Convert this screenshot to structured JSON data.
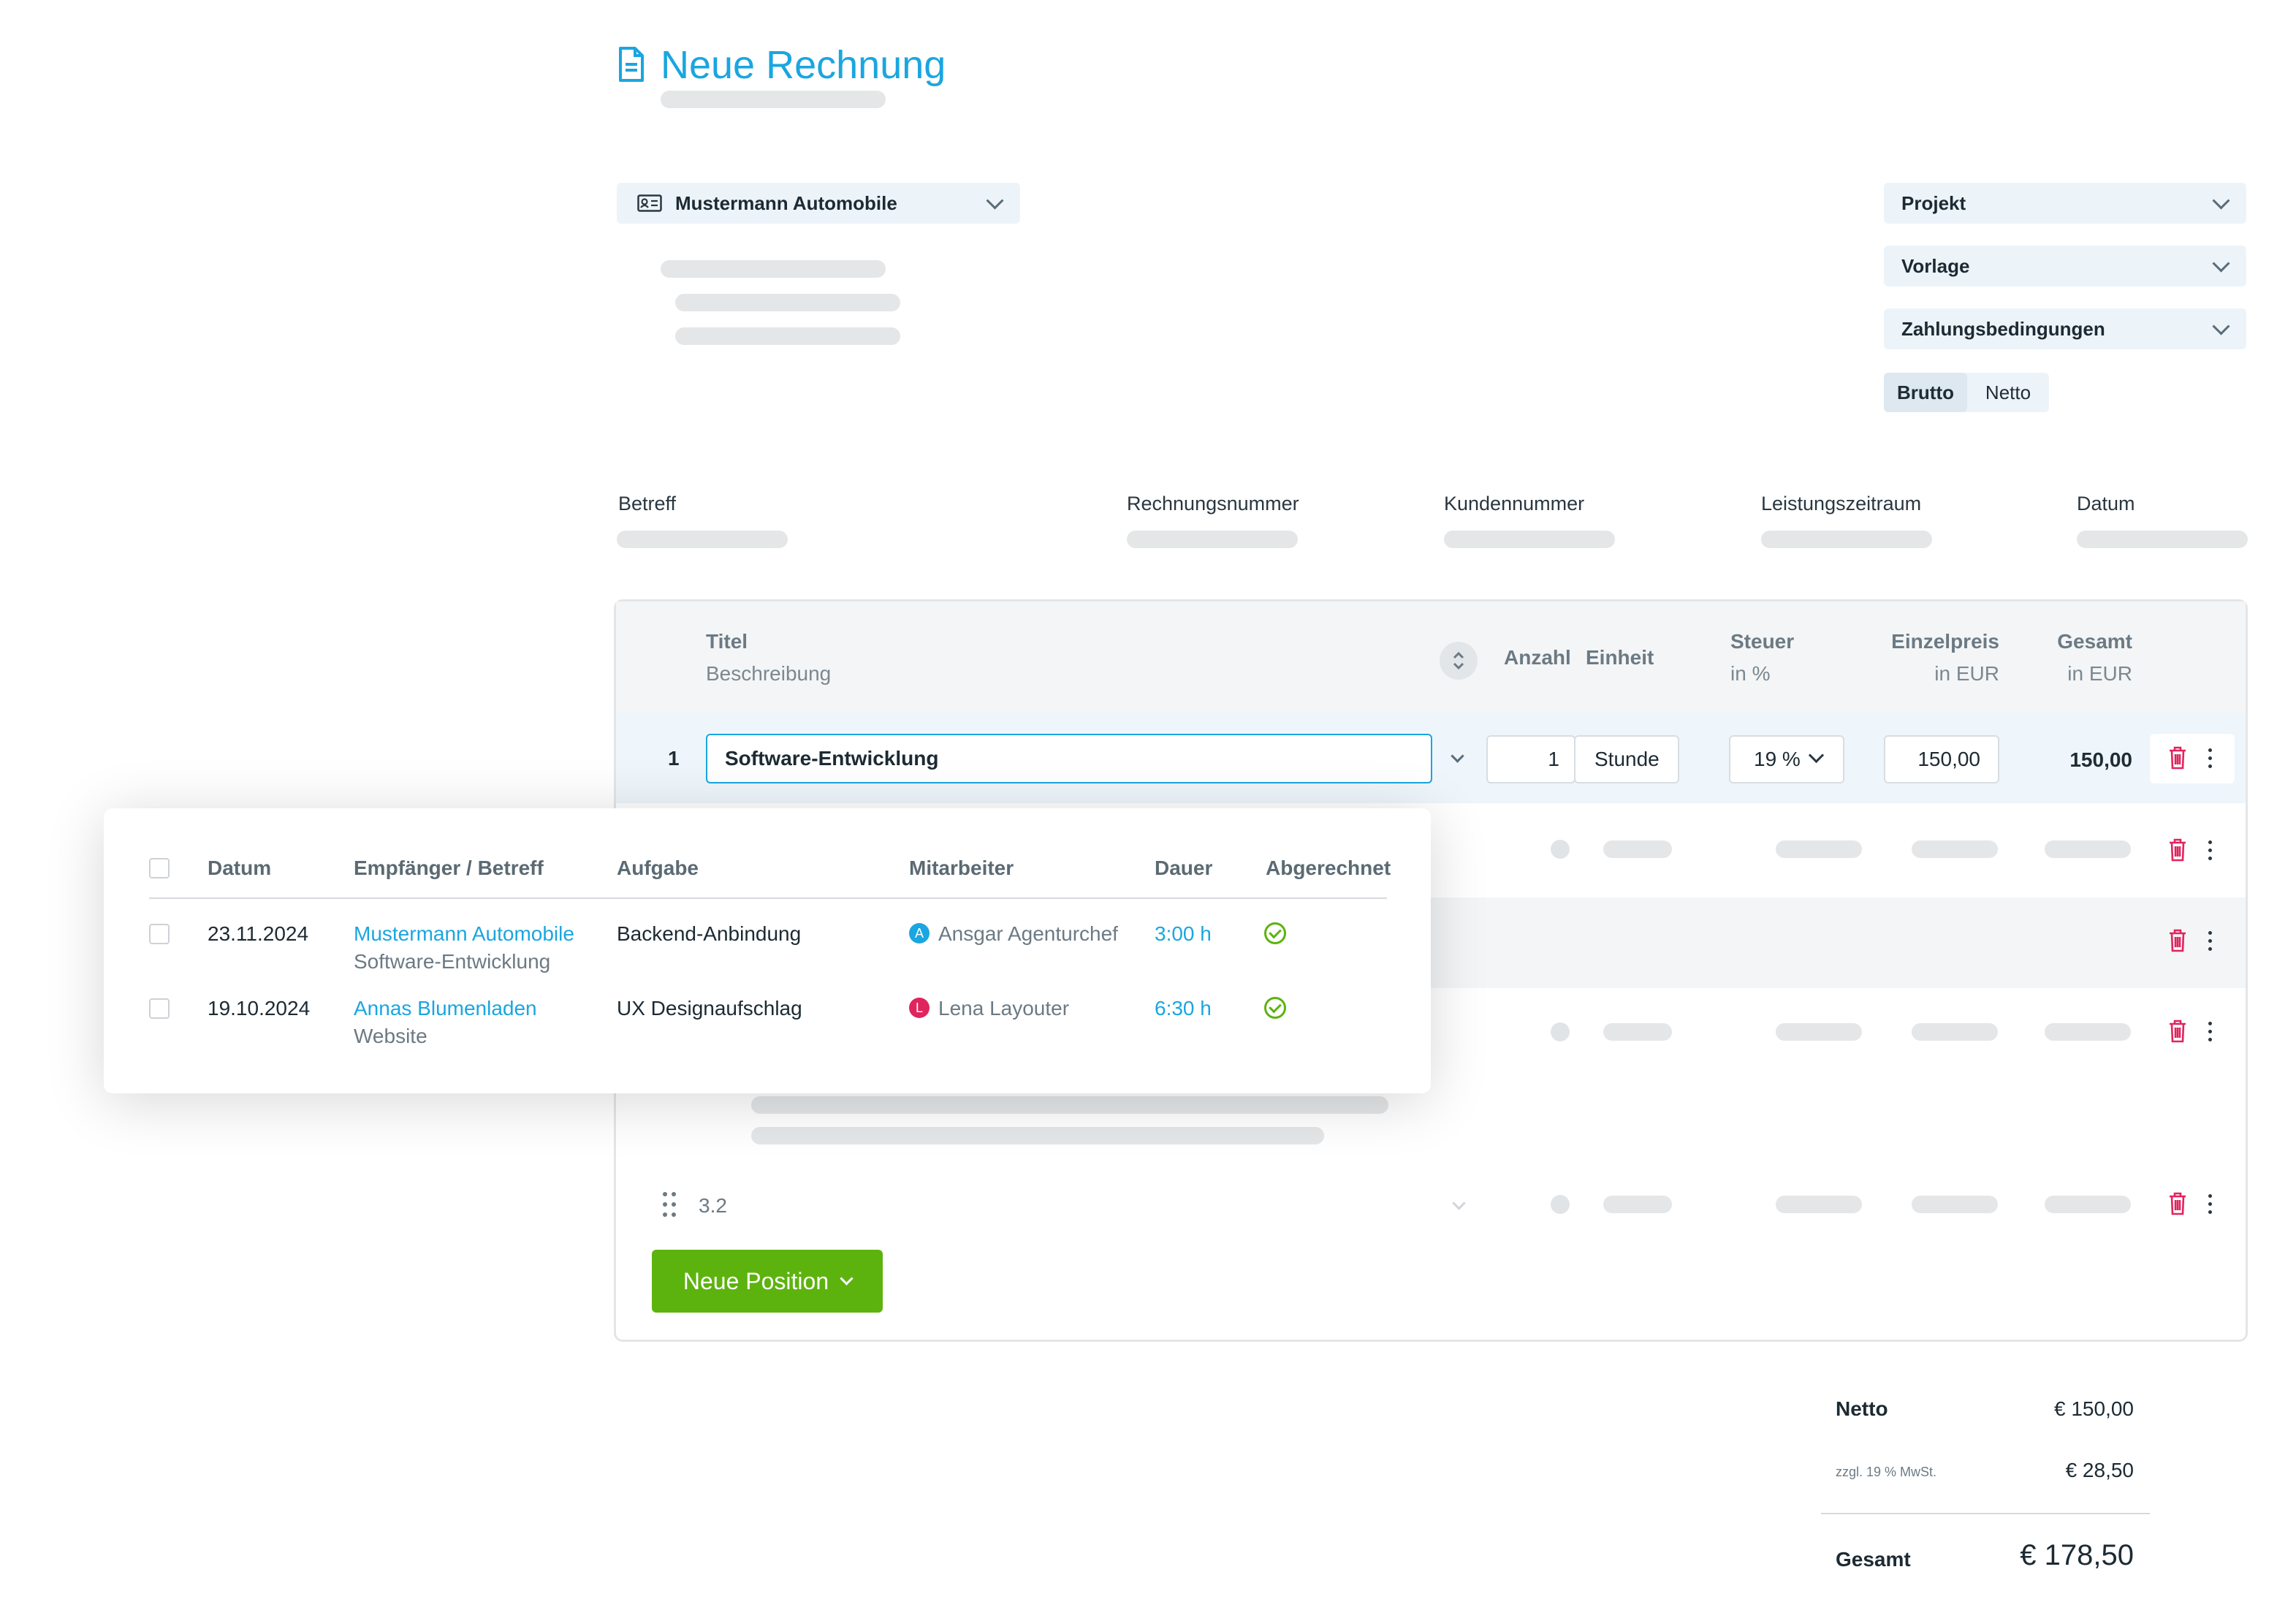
{
  "header": {
    "title": "Neue Rechnung",
    "icon": "document-icon"
  },
  "customer_select": {
    "label": "Mustermann Automobile",
    "icon": "contact-card-icon"
  },
  "right_selects": [
    {
      "label": "Projekt"
    },
    {
      "label": "Vorlage"
    },
    {
      "label": "Zahlungsbedingungen"
    }
  ],
  "price_mode": {
    "options": [
      "Brutto",
      "Netto"
    ],
    "selected": "Brutto"
  },
  "meta_fields": [
    "Betreff",
    "Rechnungsnummer",
    "Kundennummer",
    "Leistungszeitraum",
    "Datum"
  ],
  "table": {
    "headers": {
      "title": "Titel",
      "description": "Beschreibung",
      "quantity": "Anzahl",
      "unit": "Einheit",
      "tax": "Steuer",
      "tax_sub": "in %",
      "unit_price": "Einzelpreis",
      "unit_price_sub": "in EUR",
      "total": "Gesamt",
      "total_sub": "in EUR"
    },
    "row1": {
      "number": "1",
      "title": "Software-Entwicklung",
      "quantity": "1",
      "unit": "Stunde",
      "tax": "19 %",
      "unit_price": "150,00",
      "total": "150,00"
    },
    "sub_row_number": "3.2",
    "new_position_button": "Neue Position"
  },
  "time_entries": {
    "headers": [
      "Datum",
      "Empfänger / Betreff",
      "Aufgabe",
      "Mitarbeiter",
      "Dauer",
      "Abgerechnet"
    ],
    "rows": [
      {
        "date": "23.11.2024",
        "recipient": "Mustermann Automobile",
        "subject": "Software-Entwicklung",
        "task": "Backend-Anbindung",
        "employee": "Ansgar Agenturchef",
        "initial": "A",
        "avatar_color": "#1aa6e0",
        "duration": "3:00 h",
        "billed": true
      },
      {
        "date": "19.10.2024",
        "recipient": "Annas Blumenladen",
        "subject": "Website",
        "task": "UX Designaufschlag",
        "employee": "Lena Layouter",
        "initial": "L",
        "avatar_color": "#e0245e",
        "duration": "6:30 h",
        "billed": true
      }
    ]
  },
  "totals": {
    "net_label": "Netto",
    "net_value": "€ 150,00",
    "vat_label": "zzgl. 19 % MwSt.",
    "vat_value": "€ 28,50",
    "total_label": "Gesamt",
    "total_value": "€ 178,50"
  },
  "colors": {
    "accent": "#1aa6e0",
    "primary_button": "#5db30e",
    "danger": "#e0245e"
  }
}
